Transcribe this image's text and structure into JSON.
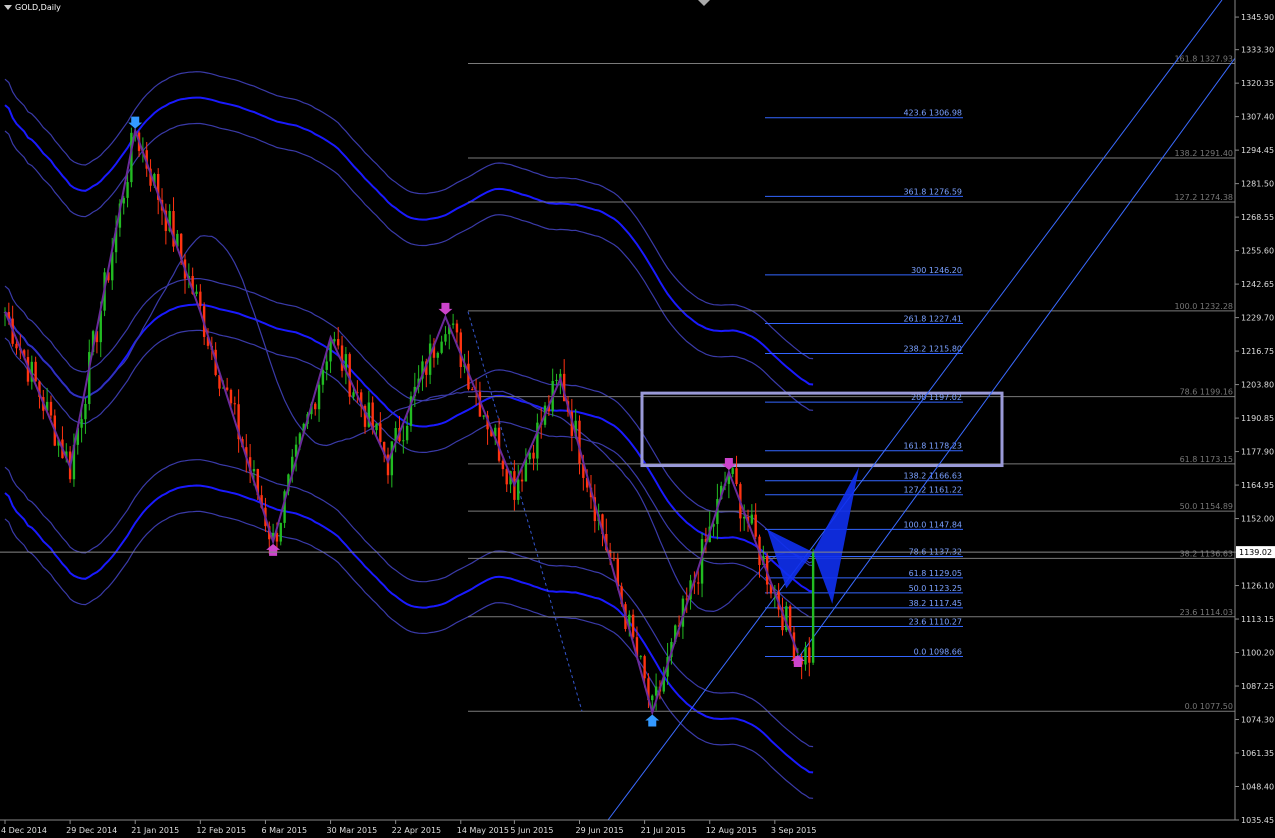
{
  "chart_title": "GOLD,Daily",
  "colors": {
    "background": "#000000",
    "bull": "#22bb22",
    "bear": "#ff3311",
    "fib_line": "#3366ff",
    "fib_gray": "#7a7a7a",
    "envelope_main": "#1a1aff",
    "envelope_band": "#3a3aa8",
    "zigzag": "#6a2a9a",
    "box": "#9a9ad8",
    "channel": "#3a6aff",
    "pattern_fill": "#1030f0",
    "current_price_bg": "#ffffff"
  },
  "chart_data": {
    "type": "candlestick",
    "symbol": "GOLD",
    "timeframe": "Daily",
    "y_range": [
      1035.45,
      1352.5
    ],
    "price_axis_labels": [
      "1345.90",
      "1333.30",
      "1320.35",
      "1307.40",
      "1294.45",
      "1281.50",
      "1268.55",
      "1255.60",
      "1242.65",
      "1229.70",
      "1216.75",
      "1203.80",
      "1190.85",
      "1177.90",
      "1164.95",
      "1152.00",
      "1139.02",
      "1126.10",
      "1113.15",
      "1100.20",
      "1087.25",
      "1074.30",
      "1061.35",
      "1048.40",
      "1035.45"
    ],
    "price_axis_values": [
      1345.9,
      1333.3,
      1320.35,
      1307.4,
      1294.45,
      1281.5,
      1268.55,
      1255.6,
      1242.65,
      1229.7,
      1216.75,
      1203.8,
      1190.85,
      1177.9,
      1164.95,
      1152.0,
      1139.02,
      1126.1,
      1113.15,
      1100.2,
      1087.25,
      1074.3,
      1061.35,
      1048.4,
      1035.45
    ],
    "current_price": "1139.02",
    "time_axis_labels": [
      "4 Dec 2014",
      "29 Dec 2014",
      "21 Jan 2015",
      "12 Feb 2015",
      "6 Mar 2015",
      "30 Mar 2015",
      "22 Apr 2015",
      "14 May 2015",
      "5 Jun 2015",
      "29 Jun 2015",
      "21 Jul 2015",
      "12 Aug 2015",
      "3 Sep 2015"
    ],
    "time_axis_index": [
      0,
      17,
      34,
      51,
      68,
      85,
      102,
      119,
      133,
      150,
      167,
      184,
      201
    ],
    "fib_blue": [
      {
        "label": "423.6  1306.98",
        "price": 1306.98
      },
      {
        "label": "361.8  1276.59",
        "price": 1276.59
      },
      {
        "label": "300  1246.20",
        "price": 1246.2
      },
      {
        "label": "261.8  1227.41",
        "price": 1227.41
      },
      {
        "label": "238.2  1215.80",
        "price": 1215.8
      },
      {
        "label": "200  1197.02",
        "price": 1197.02
      },
      {
        "label": "161.8  1178.23",
        "price": 1178.23
      },
      {
        "label": "138.2  1166.63",
        "price": 1166.63
      },
      {
        "label": "127.2  1161.22",
        "price": 1161.22
      },
      {
        "label": "100.0  1147.84",
        "price": 1147.84
      },
      {
        "label": "78.6  1137.32",
        "price": 1137.32
      },
      {
        "label": "61.8  1129.05",
        "price": 1129.05
      },
      {
        "label": "50.0  1123.25",
        "price": 1123.25
      },
      {
        "label": "38.2  1117.45",
        "price": 1117.45
      },
      {
        "label": "23.6  1110.27",
        "price": 1110.27
      },
      {
        "label": "0.0  1098.66",
        "price": 1098.66
      }
    ],
    "fib_gray": [
      {
        "label": "161.8  1327.93",
        "price": 1327.93
      },
      {
        "label": "138.2  1291.40",
        "price": 1291.4
      },
      {
        "label": "127.2  1274.38",
        "price": 1274.38
      },
      {
        "label": "100.0  1232.28",
        "price": 1232.28
      },
      {
        "label": "78.6  1199.16",
        "price": 1199.16
      },
      {
        "label": "61.8  1173.15",
        "price": 1173.15
      },
      {
        "label": "50.0  1154.89",
        "price": 1154.89
      },
      {
        "label": "38.2  1136.63",
        "price": 1136.63
      },
      {
        "label": "23.6  1114.03",
        "price": 1114.03
      },
      {
        "label": "0.0  1077.50",
        "price": 1077.5
      }
    ],
    "zigzag_points": [
      [
        0,
        1232
      ],
      [
        17,
        1172
      ],
      [
        34,
        1302
      ],
      [
        51,
        1232
      ],
      [
        70,
        1143
      ],
      [
        85,
        1222
      ],
      [
        100,
        1174
      ],
      [
        115,
        1230
      ],
      [
        133,
        1165
      ],
      [
        145,
        1206
      ],
      [
        169,
        1077
      ],
      [
        189,
        1170
      ],
      [
        207,
        1100
      ]
    ],
    "arrows": [
      {
        "index": 34,
        "price": 1302,
        "direction": "down",
        "color": "#3399ff"
      },
      {
        "index": 115,
        "price": 1230,
        "direction": "down",
        "color": "#cc44cc"
      },
      {
        "index": 70,
        "price": 1143,
        "direction": "up",
        "color": "#cc44cc"
      },
      {
        "index": 169,
        "price": 1077,
        "direction": "up",
        "color": "#3399ff"
      },
      {
        "index": 189,
        "price": 1170,
        "direction": "down",
        "color": "#cc44cc"
      },
      {
        "index": 207,
        "price": 1100,
        "direction": "up",
        "color": "#cc44cc"
      }
    ]
  }
}
